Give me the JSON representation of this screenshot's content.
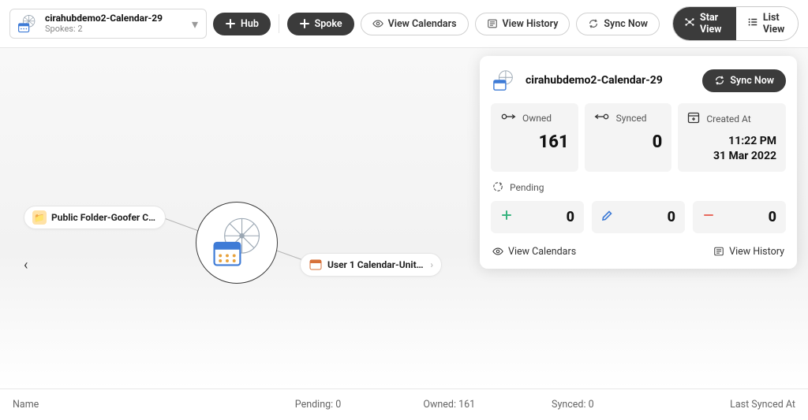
{
  "hubSelect": {
    "title": "cirahubdemo2-Calendar-29",
    "subtitle": "Spokes: 2"
  },
  "toolbar": {
    "hub": "Hub",
    "spoke": "Spoke",
    "viewCalendars": "View Calendars",
    "viewHistory": "View History",
    "syncNow": "Sync Now",
    "starView": "Star View",
    "listView": "List View"
  },
  "spokes": {
    "left": "Public Folder-Goofer Cal...",
    "right": "User 1 Calendar-United …"
  },
  "panel": {
    "title": "cirahubdemo2-Calendar-29",
    "syncNow": "Sync Now",
    "owned": {
      "label": "Owned",
      "value": "161"
    },
    "synced": {
      "label": "Synced",
      "value": "0"
    },
    "created": {
      "label": "Created At",
      "time": "11:22 PM",
      "date": "31 Mar 2022"
    },
    "pendingLabel": "Pending",
    "pending": {
      "add": "0",
      "edit": "0",
      "del": "0"
    },
    "viewCalendars": "View Calendars",
    "viewHistory": "View History"
  },
  "footer": {
    "name": "Name",
    "pending": "Pending: 0",
    "owned": "Owned: 161",
    "synced": "Synced: 0",
    "lastSynced": "Last Synced At"
  }
}
